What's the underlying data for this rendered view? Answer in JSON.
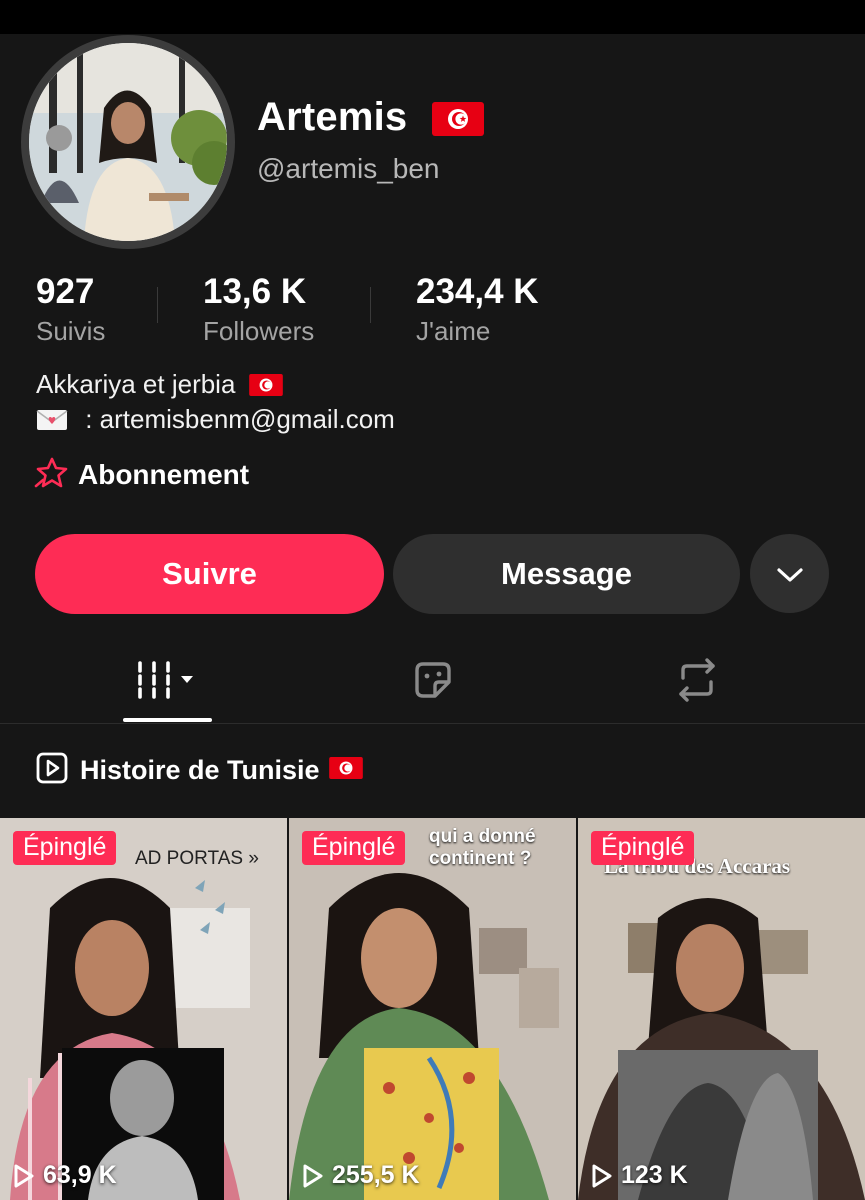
{
  "profile": {
    "name": "Artemis",
    "handle": "@artemis_ben",
    "name_flag_icon": "tunisia-flag-icon"
  },
  "stats": [
    {
      "value": "927",
      "label": "Suivis"
    },
    {
      "value": "13,6 K",
      "label": "Followers"
    },
    {
      "value": "234,4 K",
      "label": "J'aime"
    }
  ],
  "bio": {
    "line1": "Akkariya et jerbia",
    "line2": ": artemisbenm@gmail.com",
    "line2_icon": "love-letter-icon"
  },
  "subscription": {
    "label": "Abonnement",
    "icon": "star-badge-icon"
  },
  "actions": {
    "follow": "Suivre",
    "message": "Message",
    "more_icon": "chevron-down-icon"
  },
  "tabs": [
    {
      "icon": "videos-grid-icon",
      "active": true
    },
    {
      "icon": "sticker-icon",
      "active": false
    },
    {
      "icon": "repost-icon",
      "active": false
    }
  ],
  "playlist": {
    "title": "Histoire de Tunisie",
    "icon": "play-square-icon"
  },
  "videos": [
    {
      "pinned_label": "Épinglé",
      "caption": "AD PORTAS »",
      "views": "63,9 K"
    },
    {
      "pinned_label": "Épinglé",
      "caption_line1": "qui a donné",
      "caption_line2": "continent ?",
      "views": "255,5 K"
    },
    {
      "pinned_label": "Épinglé",
      "caption": "La tribu des Accaras",
      "views": "123 K"
    }
  ],
  "colors": {
    "accent": "#fe2c55",
    "background": "#161616",
    "button_dark": "#2f2f2f",
    "muted_text": "#a4a4a4"
  }
}
